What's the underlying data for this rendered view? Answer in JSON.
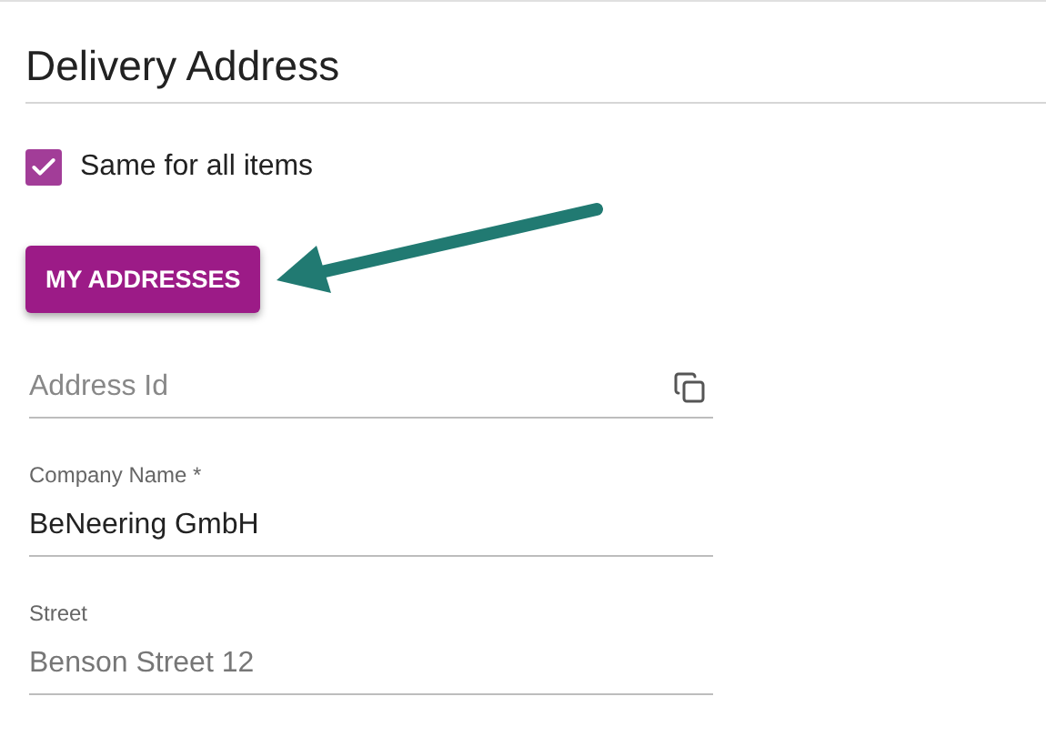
{
  "section": {
    "title": "Delivery Address"
  },
  "same_for_all": {
    "label": "Same for all items",
    "checked": true
  },
  "addresses_button": {
    "label": "MY ADDRESSES"
  },
  "fields": [
    {
      "kind": "placeholder",
      "placeholder": "Address Id"
    },
    {
      "kind": "filled",
      "label": "Company Name *",
      "value": "BeNeering GmbH"
    },
    {
      "kind": "blurred",
      "label": "Street",
      "value": "Benson Street 12"
    }
  ]
}
